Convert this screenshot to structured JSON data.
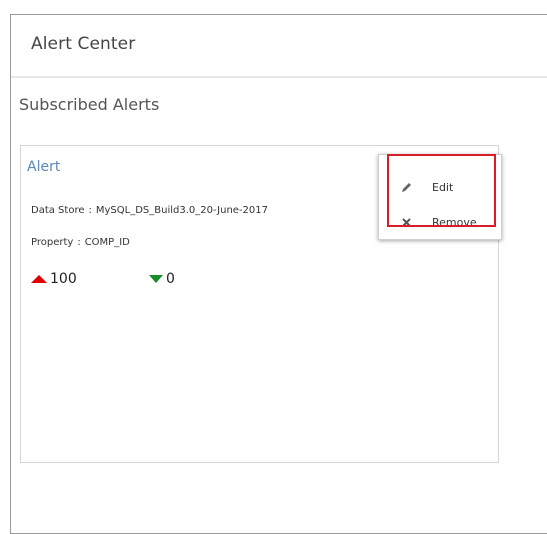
{
  "header": {
    "title": "Alert Center"
  },
  "section": {
    "title": "Subscribed Alerts"
  },
  "alert": {
    "name": "Alert",
    "data_store_label": "Data Store",
    "data_store_value": "MySQL_DS_Build3.0_20-June-2017",
    "property_label": "Property",
    "property_value": "COMP_ID",
    "separator": ":",
    "up_count": "100",
    "down_count": "0"
  },
  "menu": {
    "items": [
      {
        "label": "Edit",
        "icon": "pencil-icon"
      },
      {
        "label": "Remove",
        "icon": "x-icon"
      }
    ]
  },
  "colors": {
    "up": "#e00000",
    "down": "#1a8a2a",
    "link": "#5b88b5",
    "highlight": "#d61f26"
  }
}
